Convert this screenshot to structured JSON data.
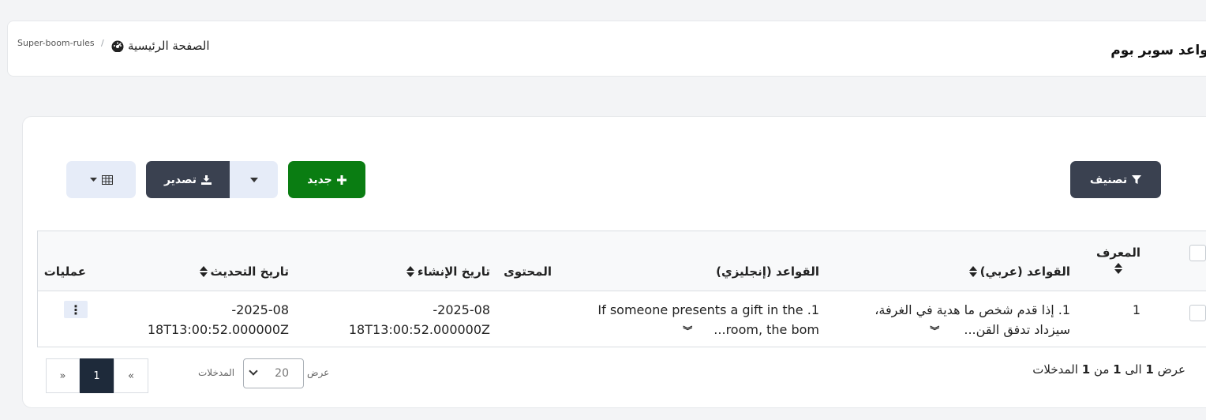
{
  "header": {
    "title": "قواعد سوبر بوم",
    "breadcrumb_home": "الصفحة الرئيسية",
    "breadcrumb_current": "Super-boom-rules"
  },
  "toolbar": {
    "filter_label": "تصنيف",
    "new_label": "جديد",
    "export_label": "تصدير"
  },
  "table": {
    "columns": {
      "id": "المعرف",
      "rules_ar": "القواعد (عربي)",
      "rules_en": "القواعد (إنجليزي)",
      "content": "المحتوى",
      "created": "تاريخ الإنشاء",
      "updated": "تاريخ التحديث",
      "actions": "عمليات"
    },
    "rows": [
      {
        "id": "1",
        "rules_ar_line1": "1. إذا قدم شخص ما هدية في الغرفة،",
        "rules_ar_line2": "سيزداد تدفق القن...",
        "rules_en_line1": "1. If someone presents a gift in the",
        "rules_en_line2": "room, the bom...",
        "content": "",
        "created_line1": "2025-08-",
        "created_line2": "18T13:00:52.000000Z",
        "updated_line1": "2025-08-",
        "updated_line2": "18T13:00:52.000000Z",
        "actions_icon": "⋮"
      }
    ]
  },
  "footer": {
    "info_prefix": "عرض",
    "info_from": "1",
    "info_to_word": "الى",
    "info_to": "1",
    "info_of_word": "من",
    "info_total": "1",
    "info_suffix": "المدخلات",
    "length_show": "عرض",
    "length_value": "20",
    "length_entries": "المدخلات",
    "pager_prev": "«",
    "pager_current": "1",
    "pager_next": "»"
  },
  "icons": {
    "home": "dashboard-icon",
    "filter": "filter-icon",
    "plus": "plus-icon",
    "download": "download-icon",
    "table": "table-icon",
    "caret": "caret-down-icon",
    "expand": "double-chevron-down-icon"
  },
  "colors": {
    "dark_button": "#3a4150",
    "green_button": "#0a7d12",
    "light_button": "#e6ecf8",
    "active_page": "#1e2a3a"
  }
}
